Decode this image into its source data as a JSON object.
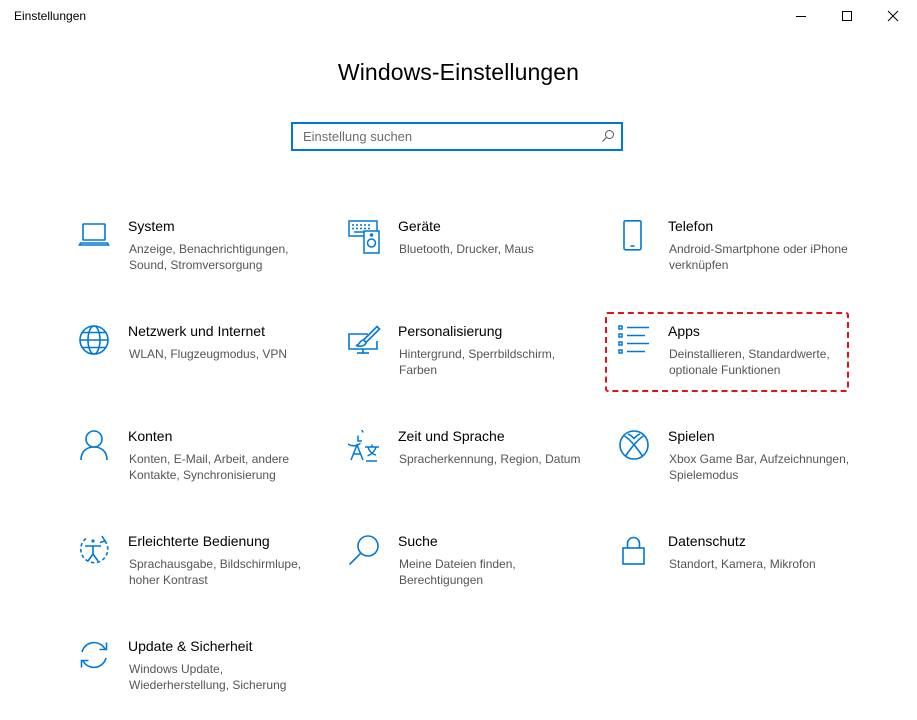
{
  "window": {
    "title": "Einstellungen",
    "buttons": {
      "minimize": "minimize",
      "maximize": "maximize",
      "close": "close"
    }
  },
  "heading": "Windows-Einstellungen",
  "search": {
    "placeholder": "Einstellung suchen",
    "value": "",
    "icon": "search-icon"
  },
  "accent_color": "#0078d7",
  "highlight_color": "#e1121b",
  "tiles": [
    {
      "title": "System",
      "description": "Anzeige, Benachrichtigungen, Sound, Stromversorgung",
      "icon": "laptop-icon"
    },
    {
      "title": "Geräte",
      "description": "Bluetooth, Drucker, Maus",
      "icon": "devices-icon"
    },
    {
      "title": "Telefon",
      "description": "Android-Smartphone oder iPhone verknüpfen",
      "icon": "phone-icon"
    },
    {
      "title": "Netzwerk und Internet",
      "description": "WLAN, Flugzeugmodus, VPN",
      "icon": "globe-icon"
    },
    {
      "title": "Personalisierung",
      "description": "Hintergrund, Sperrbildschirm, Farben",
      "icon": "personalization-icon"
    },
    {
      "title": "Apps",
      "description": "Deinstallieren, Standardwerte, optionale Funktionen",
      "icon": "apps-list-icon",
      "highlighted": true
    },
    {
      "title": "Konten",
      "description": "Konten, E-Mail, Arbeit, andere Kontakte, Synchronisierung",
      "icon": "person-icon"
    },
    {
      "title": "Zeit und Sprache",
      "description": "Spracherkennung, Region, Datum",
      "icon": "time-language-icon"
    },
    {
      "title": "Spielen",
      "description": "Xbox Game Bar, Aufzeichnungen, Spielemodus",
      "icon": "xbox-icon"
    },
    {
      "title": "Erleichterte Bedienung",
      "description": "Sprachausgabe, Bildschirmlupe, hoher Kontrast",
      "icon": "ease-of-access-icon"
    },
    {
      "title": "Suche",
      "description": "Meine Dateien finden, Berechtigungen",
      "icon": "search-icon"
    },
    {
      "title": "Datenschutz",
      "description": "Standort, Kamera, Mikrofon",
      "icon": "lock-icon"
    },
    {
      "title": "Update & Sicherheit",
      "description": "Windows Update, Wiederherstellung, Sicherung",
      "icon": "update-icon"
    }
  ]
}
